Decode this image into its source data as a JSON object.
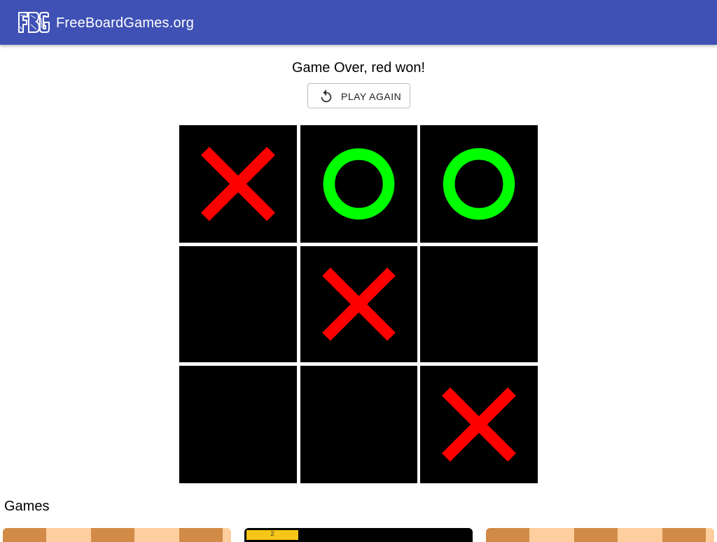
{
  "header": {
    "brand": "FreeBoardGames.org",
    "logo_text": "FBG",
    "background_color": "#3f51b5"
  },
  "game": {
    "status": "Game Over, red won!",
    "play_again_label": "PLAY AGAIN",
    "play_again_icon": "replay-icon",
    "board": [
      [
        "X",
        "O",
        "O"
      ],
      [
        "",
        "X",
        ""
      ],
      [
        "",
        "",
        "X"
      ]
    ],
    "x_color": "#ff0000",
    "o_color": "#00ff00",
    "cell_color": "#000000"
  },
  "games_section": {
    "heading": "Games",
    "cards": [
      {
        "name": "chess-preview"
      },
      {
        "name": "dark-preview",
        "mini_label": "2"
      },
      {
        "name": "checkers-preview"
      }
    ]
  }
}
